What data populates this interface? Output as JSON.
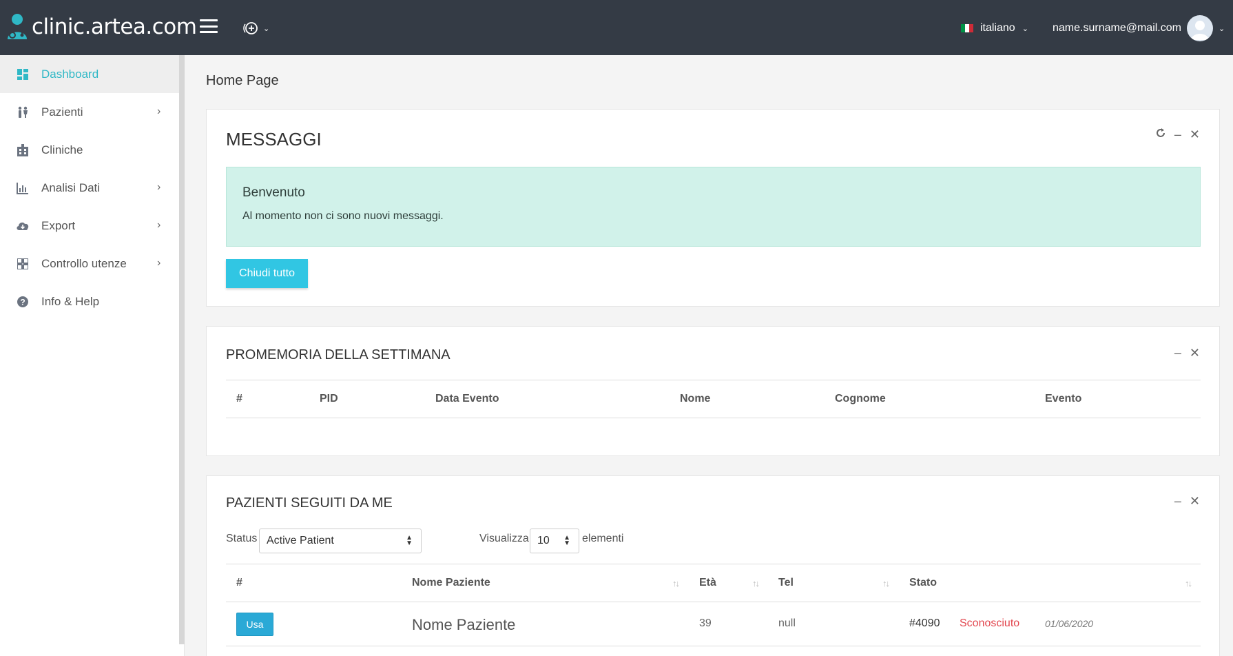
{
  "app": {
    "brand": "clinic.artea.com",
    "colors": {
      "topbar": "#343b45",
      "accent": "#2fb8c6",
      "alert_bg": "#d1f2ea",
      "button": "#31c6e3",
      "danger": "#e2474f"
    }
  },
  "header": {
    "language": "italiano",
    "user_email": "name.surname@mail.com"
  },
  "sidebar": {
    "items": [
      {
        "label": "Dashboard",
        "icon": "dashboard-icon",
        "active": true
      },
      {
        "label": "Pazienti",
        "icon": "people-icon",
        "has_arrow": true
      },
      {
        "label": "Cliniche",
        "icon": "hospital-icon"
      },
      {
        "label": "Analisi Dati",
        "icon": "bar-chart-icon",
        "has_arrow": true
      },
      {
        "label": "Export",
        "icon": "cloud-download-icon",
        "has_arrow": true
      },
      {
        "label": "Controllo utenze",
        "icon": "grid-icon",
        "has_arrow": true
      },
      {
        "label": "Info & Help",
        "icon": "help-circle-icon"
      }
    ]
  },
  "main": {
    "page_title": "Home Page",
    "messages": {
      "title": "MESSAGGI",
      "alert_title": "Benvenuto",
      "alert_text": "Al momento non ci sono nuovi messaggi.",
      "close_all": "Chiudi tutto"
    },
    "reminders": {
      "title": "PROMEMORIA DELLA SETTIMANA",
      "columns": [
        "#",
        "PID",
        "Data Evento",
        "Nome",
        "Cognome",
        "Evento"
      ]
    },
    "patients": {
      "title": "PAZIENTI SEGUITI DA ME",
      "status_label": "Status",
      "status_value": "Active Patient",
      "show_label": "Visualizza",
      "show_value": "10",
      "show_suffix": "elementi",
      "columns": [
        "#",
        "Nome Paziente",
        "Età",
        "Tel",
        "Stato"
      ],
      "rows": [
        {
          "action": "Usa",
          "name": "Nome Paziente",
          "age": "39",
          "tel": "null",
          "id": "#4090",
          "status": "Sconosciuto",
          "date": "01/06/2020"
        }
      ]
    }
  }
}
